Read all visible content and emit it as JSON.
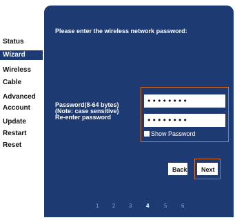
{
  "sidebar": {
    "items": [
      {
        "label": "Status",
        "active": false
      },
      {
        "label": "Wizard",
        "active": true
      },
      {
        "label": "Wireless",
        "active": false
      },
      {
        "label": "Cable",
        "active": false
      },
      {
        "label": "Advanced",
        "active": false
      },
      {
        "label": "Account",
        "active": false
      },
      {
        "label": "Update",
        "active": false
      },
      {
        "label": "Restart",
        "active": false
      },
      {
        "label": "Reset",
        "active": false
      }
    ]
  },
  "wizard": {
    "heading": "Please enter the wireless network password:",
    "password_label": "Password(8-64 bytes)",
    "note_label": "(Note: case sensitive)",
    "reenter_label": "Re-enter password",
    "password_value": "••••••••",
    "reenter_value": "••••••••",
    "show_password_label": "Show Password",
    "show_password_checked": false,
    "back_label": "Back",
    "next_label": "Next",
    "steps": [
      "1",
      "2",
      "3",
      "4",
      "5",
      "6"
    ],
    "current_step": "4"
  },
  "colors": {
    "panel": "#1d3a73",
    "highlight_border": "#e07020",
    "inactive_step": "#8aa0c8"
  }
}
